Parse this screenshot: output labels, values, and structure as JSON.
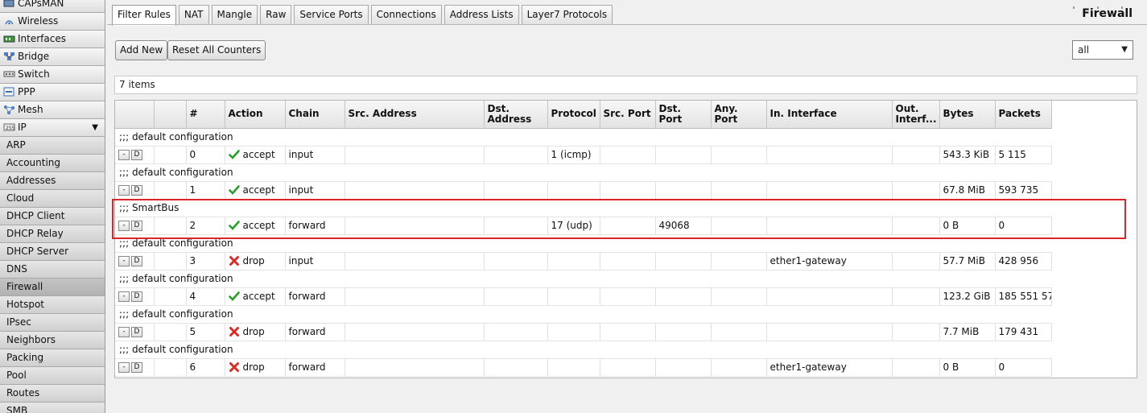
{
  "sidebar": {
    "items": [
      {
        "label": "CAPsMAN",
        "icon": "capsman-icon",
        "sub": false
      },
      {
        "label": "Wireless",
        "icon": "wireless-icon",
        "sub": false
      },
      {
        "label": "Interfaces",
        "icon": "interfaces-icon",
        "sub": false
      },
      {
        "label": "Bridge",
        "icon": "bridge-icon",
        "sub": false
      },
      {
        "label": "Switch",
        "icon": "switch-icon",
        "sub": false
      },
      {
        "label": "PPP",
        "icon": "ppp-icon",
        "sub": false
      },
      {
        "label": "Mesh",
        "icon": "mesh-icon",
        "sub": false
      },
      {
        "label": "IP",
        "icon": "ip-icon",
        "sub": false,
        "expanded": true
      },
      {
        "label": "ARP",
        "sub": true
      },
      {
        "label": "Accounting",
        "sub": true
      },
      {
        "label": "Addresses",
        "sub": true
      },
      {
        "label": "Cloud",
        "sub": true
      },
      {
        "label": "DHCP Client",
        "sub": true
      },
      {
        "label": "DHCP Relay",
        "sub": true
      },
      {
        "label": "DHCP Server",
        "sub": true
      },
      {
        "label": "DNS",
        "sub": true
      },
      {
        "label": "Firewall",
        "sub": true,
        "active": true
      },
      {
        "label": "Hotspot",
        "sub": true
      },
      {
        "label": "IPsec",
        "sub": true
      },
      {
        "label": "Neighbors",
        "sub": true
      },
      {
        "label": "Packing",
        "sub": true
      },
      {
        "label": "Pool",
        "sub": true
      },
      {
        "label": "Routes",
        "sub": true
      },
      {
        "label": "SMB",
        "sub": true
      }
    ]
  },
  "tabs": [
    "Filter Rules",
    "NAT",
    "Mangle",
    "Raw",
    "Service Ports",
    "Connections",
    "Address Lists",
    "Layer7 Protocols"
  ],
  "active_tab": "Filter Rules",
  "page_title": "Firewall",
  "toolbar": {
    "add_label": "Add New",
    "reset_label": "Reset All Counters"
  },
  "filter": {
    "selected": "all"
  },
  "items_count": "7 items",
  "table": {
    "columns": [
      "",
      "",
      "#",
      "Action",
      "Chain",
      "Src. Address",
      "Dst. Address",
      "Protocol",
      "Src. Port",
      "Dst. Port",
      "Any. Port",
      "In. Interface",
      "Out. Interf...",
      "Bytes",
      "Packets"
    ],
    "rows": [
      {
        "comment": ";;; default configuration",
        "num": "0",
        "action": "accept",
        "chain": "input",
        "src": "",
        "dst": "",
        "protocol": "1 (icmp)",
        "sport": "",
        "dport": "",
        "aport": "",
        "in_if": "",
        "out_if": "",
        "bytes": "543.3 KiB",
        "packets": "5 115"
      },
      {
        "comment": ";;; default configuration",
        "num": "1",
        "action": "accept",
        "chain": "input",
        "src": "",
        "dst": "",
        "protocol": "",
        "sport": "",
        "dport": "",
        "aport": "",
        "in_if": "",
        "out_if": "",
        "bytes": "67.8 MiB",
        "packets": "593 735"
      },
      {
        "comment": ";;; SmartBus",
        "num": "2",
        "action": "accept",
        "chain": "forward",
        "src": "",
        "dst": "",
        "protocol": "17 (udp)",
        "sport": "",
        "dport": "49068",
        "aport": "",
        "in_if": "",
        "out_if": "",
        "bytes": "0 B",
        "packets": "0"
      },
      {
        "comment": ";;; default configuration",
        "num": "3",
        "action": "drop",
        "chain": "input",
        "src": "",
        "dst": "",
        "protocol": "",
        "sport": "",
        "dport": "",
        "aport": "",
        "in_if": "ether1-gateway",
        "out_if": "",
        "bytes": "57.7 MiB",
        "packets": "428 956"
      },
      {
        "comment": ";;; default configuration",
        "num": "4",
        "action": "accept",
        "chain": "forward",
        "src": "",
        "dst": "",
        "protocol": "",
        "sport": "",
        "dport": "",
        "aport": "",
        "in_if": "",
        "out_if": "",
        "bytes": "123.2 GiB",
        "packets": "185 551 57"
      },
      {
        "comment": ";;; default configuration",
        "num": "5",
        "action": "drop",
        "chain": "forward",
        "src": "",
        "dst": "",
        "protocol": "",
        "sport": "",
        "dport": "",
        "aport": "",
        "in_if": "",
        "out_if": "",
        "bytes": "7.7 MiB",
        "packets": "179 431"
      },
      {
        "comment": ";;; default configuration",
        "num": "6",
        "action": "drop",
        "chain": "forward",
        "src": "",
        "dst": "",
        "protocol": "",
        "sport": "",
        "dport": "",
        "aport": "",
        "in_if": "ether1-gateway",
        "out_if": "",
        "bytes": "0 B",
        "packets": "0"
      }
    ],
    "row_button_minus": "-",
    "row_button_d": "D"
  },
  "colors": {
    "accept": "#2a9d2a",
    "drop": "#d0302a",
    "highlight": "#d9252e"
  }
}
